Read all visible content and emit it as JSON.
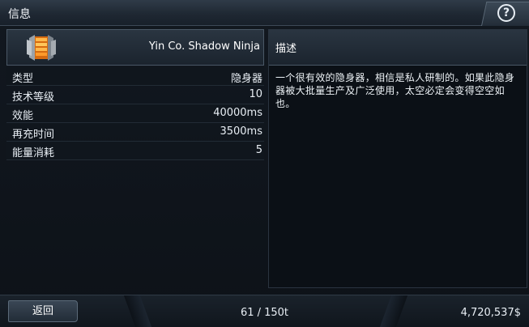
{
  "window": {
    "title": "信息"
  },
  "item": {
    "name": "Yin Co. Shadow Ninja",
    "icon": "cloaking-device-icon"
  },
  "stats": [
    {
      "label": "类型",
      "value": "隐身器"
    },
    {
      "label": "技术等级",
      "value": "10"
    },
    {
      "label": "效能",
      "value": "40000ms"
    },
    {
      "label": "再充时间",
      "value": "3500ms"
    },
    {
      "label": "能量消耗",
      "value": "5"
    }
  ],
  "description": {
    "title": "描述",
    "text": "一个很有效的隐身器，相信是私人研制的。如果此隐身器被大批量生产及广泛使用，太空必定会变得空空如也。"
  },
  "footer": {
    "back_label": "返回",
    "cargo": "61 / 150t",
    "credits": "4,720,537$"
  },
  "colors": {
    "accent": "#4a5866",
    "background": "#0a0e13",
    "icon_orange": "#e87a1c"
  }
}
